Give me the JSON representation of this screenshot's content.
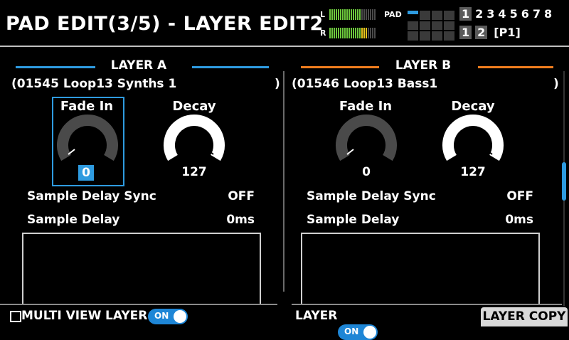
{
  "header": {
    "title": "PAD EDIT(3/5) - LAYER EDIT2",
    "meter_left_label": "L",
    "meter_right_label": "R",
    "pad_label": "PAD",
    "bank_numbers": [
      "1",
      "2",
      "3",
      "4",
      "5",
      "6",
      "7",
      "8"
    ],
    "pad_numbers": [
      "1",
      "2"
    ],
    "pattern": "[P1]"
  },
  "layer_a": {
    "title": "LAYER A",
    "wave": "(01545 Loop13 Synths 1",
    "wave_end": ")",
    "fade_in_label": "Fade In",
    "fade_in_value": "0",
    "decay_label": "Decay",
    "decay_value": "127",
    "sample_delay_sync_label": "Sample Delay Sync",
    "sample_delay_sync_value": "OFF",
    "sample_delay_label": "Sample Delay",
    "sample_delay_value": "0ms",
    "accent": "#2e9be0"
  },
  "layer_b": {
    "title": "LAYER B",
    "wave": "(01546 Loop13 Bass1",
    "wave_end": ")",
    "fade_in_label": "Fade In",
    "fade_in_value": "0",
    "decay_label": "Decay",
    "decay_value": "127",
    "sample_delay_sync_label": "Sample Delay Sync",
    "sample_delay_sync_value": "OFF",
    "sample_delay_label": "Sample Delay",
    "sample_delay_value": "0ms",
    "accent": "#f07d1e"
  },
  "footer": {
    "multi_view": "MULTI VIEW",
    "layer_a_toggle_label": "LAYER",
    "layer_a_toggle_state": "ON",
    "layer_b_toggle_label": "LAYER",
    "layer_b_toggle_state": "ON",
    "layer_copy": "LAYER COPY"
  }
}
